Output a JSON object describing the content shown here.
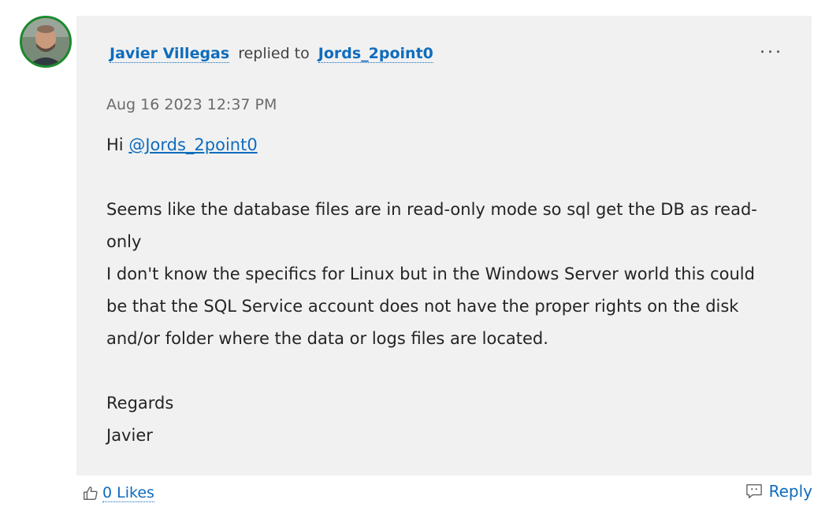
{
  "post": {
    "author": "Javier Villegas",
    "replied_text": "replied to",
    "reply_target": "Jords_2point0",
    "more_label": "...",
    "timestamp": "Aug 16 2023 12:37 PM",
    "greeting": "Hi",
    "mention": "@Jords_2point0",
    "paragraph1": "Seems like the database files are in read-only mode so sql get the DB as read-only",
    "paragraph2": "I don't know the specifics for Linux but in the Windows Server world this could be that the SQL Service account does not have the proper rights on the disk and/or folder where the data or logs files are located.",
    "signoff": "Regards",
    "signature": "Javier"
  },
  "footer": {
    "likes_label": "0 Likes",
    "reply_label": "Reply"
  },
  "colors": {
    "link": "#0f6cbd",
    "card_background": "#f1f1f1",
    "avatar_ring": "#1b8a2c"
  },
  "icons": {
    "like": "thumbs-up-icon",
    "reply": "reply-comment-icon",
    "more": "ellipsis-icon"
  }
}
